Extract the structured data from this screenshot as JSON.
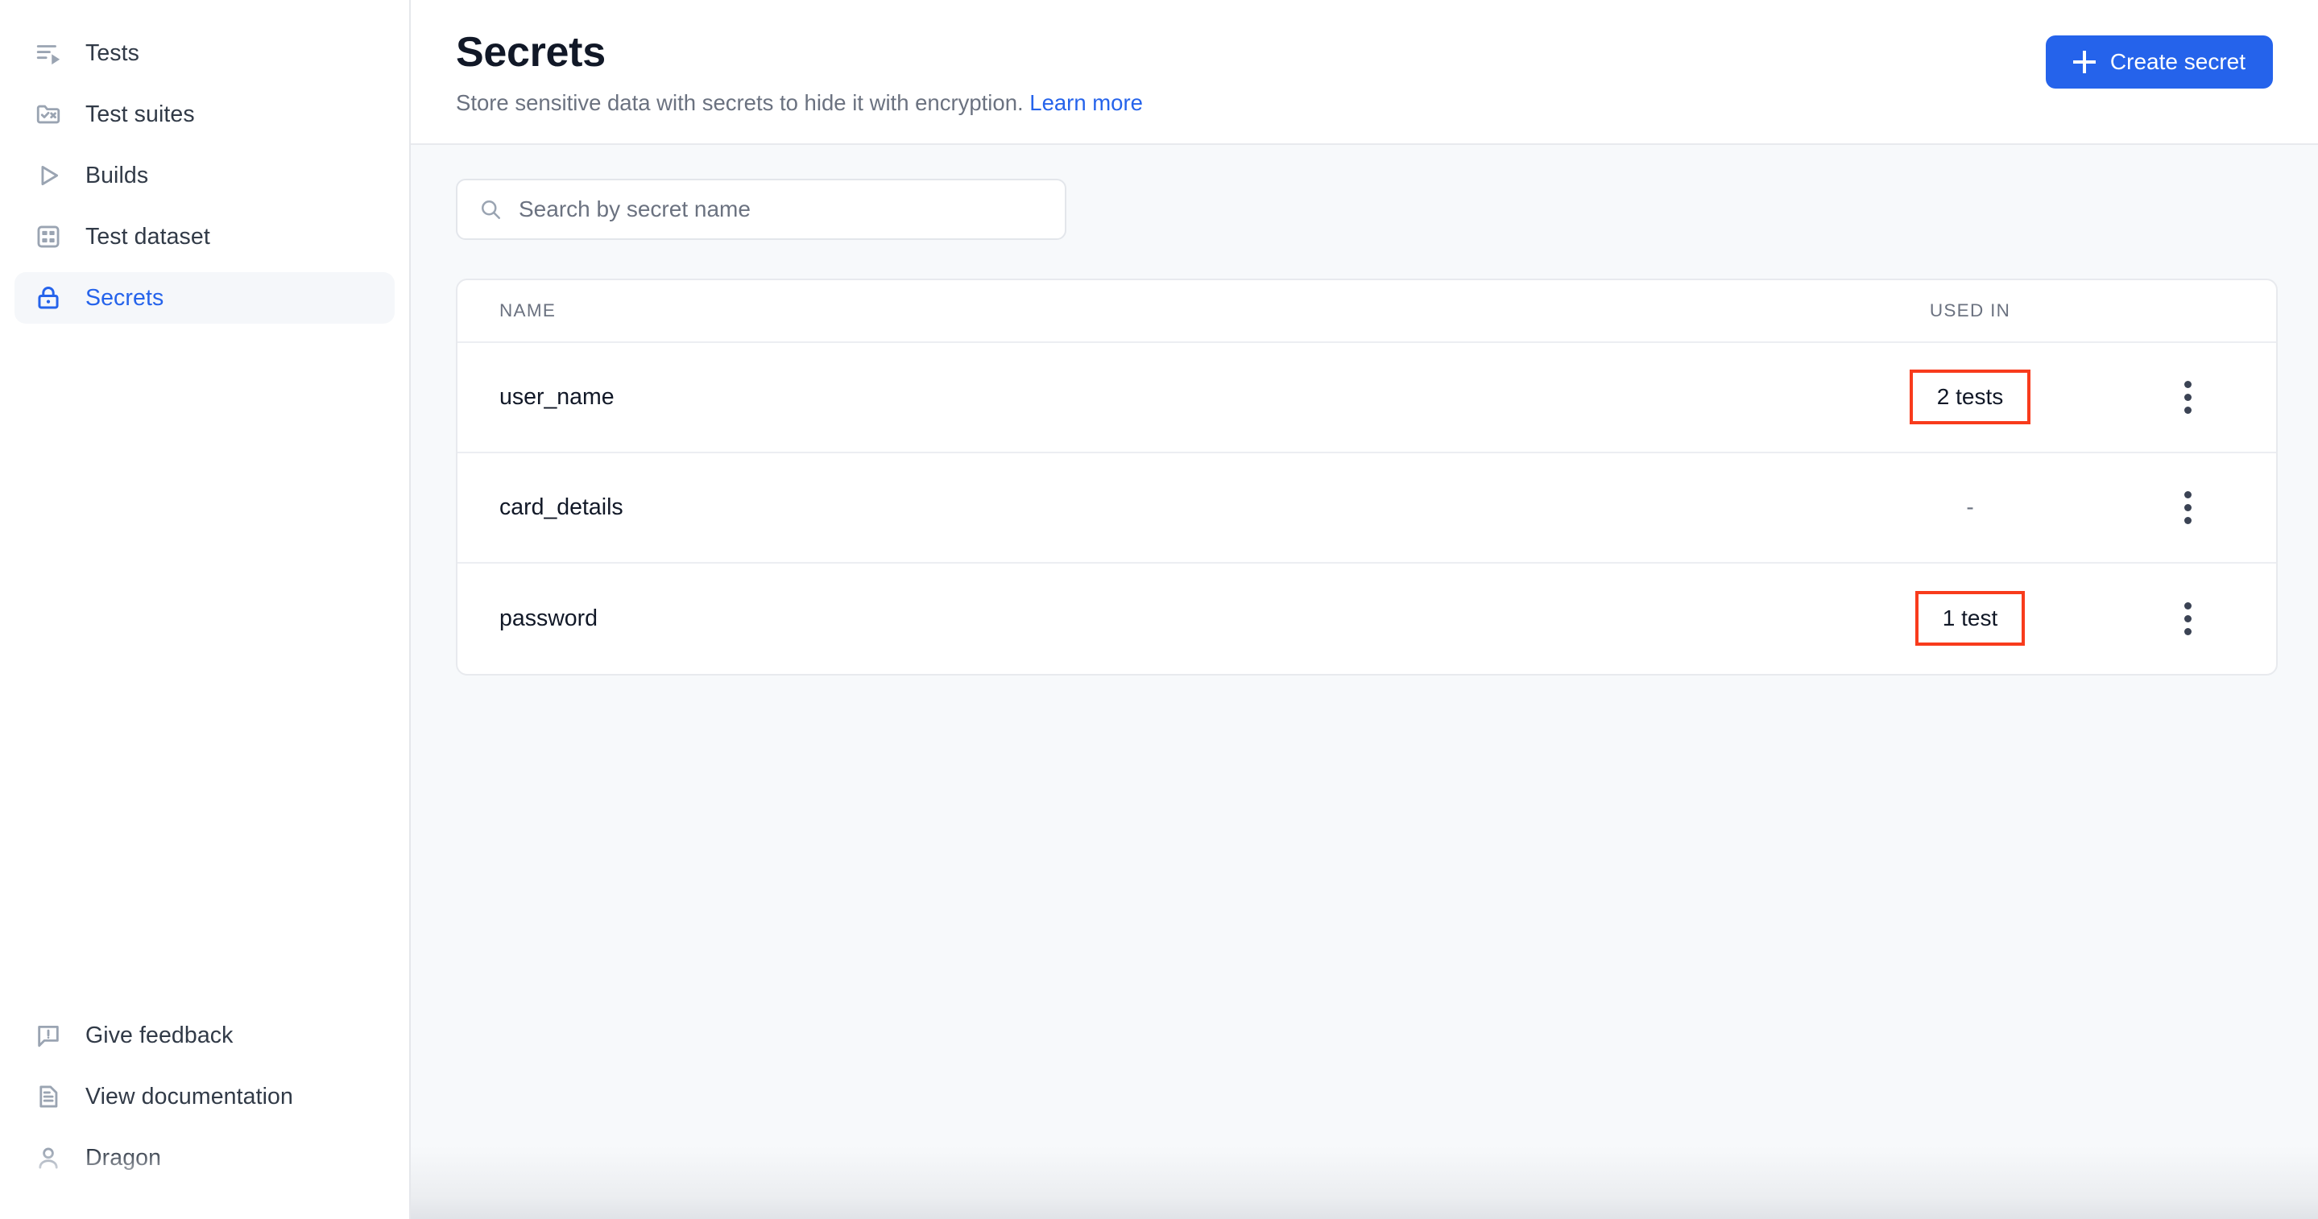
{
  "sidebar": {
    "primary_items": [
      {
        "label": "Tests",
        "icon": "tests-run-icon",
        "active": false
      },
      {
        "label": "Test suites",
        "icon": "folder-check-icon",
        "active": false
      },
      {
        "label": "Builds",
        "icon": "play-icon",
        "active": false
      },
      {
        "label": "Test dataset",
        "icon": "grid-table-icon",
        "active": false
      },
      {
        "label": "Secrets",
        "icon": "lock-icon",
        "active": true
      }
    ],
    "secondary_items": [
      {
        "label": "Give feedback",
        "icon": "feedback-bubble-icon"
      },
      {
        "label": "View documentation",
        "icon": "document-icon"
      },
      {
        "label": "Dragon",
        "icon": "user-icon"
      }
    ]
  },
  "header": {
    "title": "Secrets",
    "subtitle_text": "Store sensitive data with secrets to hide it with encryption.",
    "subtitle_link": "Learn more",
    "create_button": "Create secret",
    "create_button_icon": "plus-icon"
  },
  "search": {
    "placeholder": "Search by secret name",
    "value": "",
    "icon": "search-icon"
  },
  "table": {
    "columns": [
      "NAME",
      "USED IN"
    ],
    "rows": [
      {
        "name": "user_name",
        "used_in": "2 tests",
        "highlighted": true,
        "menu_icon": "kebab-menu-icon"
      },
      {
        "name": "card_details",
        "used_in": "-",
        "highlighted": false,
        "menu_icon": "kebab-menu-icon"
      },
      {
        "name": "password",
        "used_in": "1 test",
        "highlighted": true,
        "menu_icon": "kebab-menu-icon"
      }
    ]
  },
  "colors": {
    "accent": "#2563eb",
    "highlight_border": "#f83b1c",
    "text_primary": "#111827",
    "text_muted": "#6b7280",
    "sidebar_active_bg": "#f5f7fa",
    "page_bg": "#f7f9fb"
  }
}
